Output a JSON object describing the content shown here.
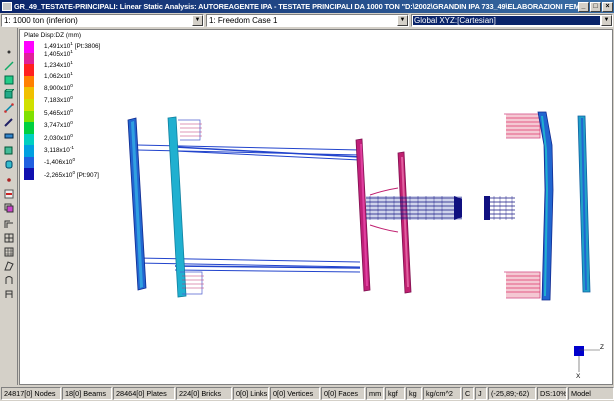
{
  "window": {
    "title": "GR_49_TESTATE-PRINCIPALI: Linear Static Analysis: AUTOREAGENTE IPA - TESTATE PRINCIPALI DA 1000 TON    \"D:\\2002\\GRANDIN IPA 733_49\\ELABORAZIONI FEM\\MO...",
    "min_glyph": "_",
    "max_glyph": "□",
    "close_glyph": "×"
  },
  "combos": {
    "load_case": "1: 1000 ton (inferion)",
    "freedom_case": "1: Freedom Case 1",
    "coord_system": "Global XYZ:[Cartesian]"
  },
  "legend": {
    "title": "Plate Disp:DZ (mm)",
    "entries": [
      {
        "m": "1,491x10",
        "e": "1",
        "s": " [Pt:3806]"
      },
      {
        "m": "1,405x10",
        "e": "1",
        "s": ""
      },
      {
        "m": "1,234x10",
        "e": "1",
        "s": ""
      },
      {
        "m": "1,062x10",
        "e": "1",
        "s": ""
      },
      {
        "m": "8,900x10",
        "e": "0",
        "s": ""
      },
      {
        "m": "7,183x10",
        "e": "0",
        "s": ""
      },
      {
        "m": "5,465x10",
        "e": "0",
        "s": ""
      },
      {
        "m": "3,747x10",
        "e": "0",
        "s": ""
      },
      {
        "m": "2,030x10",
        "e": "0",
        "s": ""
      },
      {
        "m": "3,118x10",
        "e": "-1",
        "s": ""
      },
      {
        "m": "-1,406x10",
        "e": "0",
        "s": ""
      },
      {
        "m": "-2,265x10",
        "e": "0",
        "s": " [Pt:907]"
      }
    ],
    "colors": [
      "#ff00ff",
      "#e0209a",
      "#ff2020",
      "#ff8000",
      "#f0c000",
      "#d0e000",
      "#80e000",
      "#00d040",
      "#00d0c0",
      "#00a0e0",
      "#2060e0",
      "#1010b0"
    ]
  },
  "colors": {
    "blue_member": "#2244cc",
    "cyan_member": "#20b0d0",
    "magenta_member": "#c0207a",
    "navy_member": "#101080",
    "pink_head": "#e0206a",
    "axis_blue": "#0000cc"
  },
  "axis": {
    "z_label": "Z",
    "x_label": "X"
  },
  "toolbar": {
    "icons": [
      "node-icon",
      "line-icon",
      "plate-icon",
      "brick-icon",
      "link-icon",
      "pencil-icon",
      "beam-icon",
      "cube-icon",
      "cylinder-icon",
      "point-icon",
      "attribute-icon",
      "copy-icon",
      "frame-icon",
      "grid-icon",
      "mesh-icon",
      "sheet-icon",
      "shell-icon",
      "wrap-icon"
    ]
  },
  "status": [
    "24817[0] Nodes",
    "18[0] Beams",
    "28464[0] Plates",
    "224[0] Bricks",
    "0[0] Links",
    "0[0] Vertices",
    "0[0] Faces",
    "mm",
    "kgf",
    "kg",
    "kg/cm^2",
    "C",
    "J",
    "(-25,89;-62)",
    "DS:10%",
    "Model"
  ]
}
